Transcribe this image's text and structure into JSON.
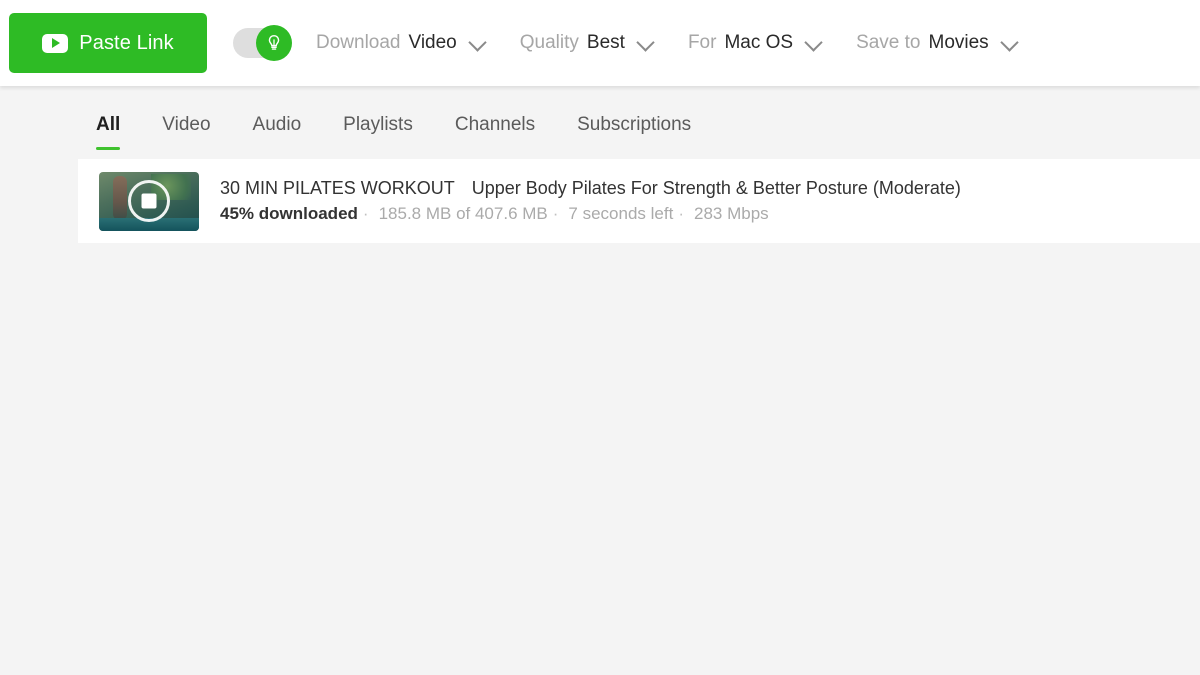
{
  "toolbar": {
    "paste_link": {
      "label": "Paste Link",
      "icon": "youtube-play-icon"
    },
    "smart_mode_toggle": {
      "state": "on",
      "icon": "lightbulb-icon"
    },
    "controls": [
      {
        "label": "Download",
        "value": "Video",
        "icon": "chevron-down-icon"
      },
      {
        "label": "Quality",
        "value": "Best",
        "icon": "chevron-down-icon"
      },
      {
        "label": "For",
        "value": "Mac OS",
        "icon": "chevron-down-icon"
      },
      {
        "label": "Save to",
        "value": "Movies",
        "icon": "chevron-down-icon"
      }
    ]
  },
  "tabs": [
    {
      "label": "All",
      "active": true
    },
    {
      "label": "Video",
      "active": false
    },
    {
      "label": "Audio",
      "active": false
    },
    {
      "label": "Playlists",
      "active": false
    },
    {
      "label": "Channels",
      "active": false
    },
    {
      "label": "Subscriptions",
      "active": false
    }
  ],
  "downloads": [
    {
      "title_main": "30 MIN PILATES WORKOUT",
      "title_sub": "Upper Body Pilates For Strength & Better Posture (Moderate)",
      "progress_text": "45% downloaded",
      "size_text": "185.8 MB of 407.6 MB",
      "time_left": "7 seconds left",
      "speed": "283 Mbps",
      "separator": "·",
      "thumbnail_icon": "video-thumbnail",
      "progress_ring_icon": "progress-ring-icon",
      "stop_icon": "stop-square-icon"
    }
  ],
  "colors": {
    "accent_green": "#2ebb25",
    "tab_underline": "#3fc22e",
    "toolbar_bg": "#ffffff",
    "content_bg": "#f4f4f4",
    "card_bg": "#ffffff",
    "text_dark": "#333333",
    "text_dim": "#aaaaaa"
  }
}
